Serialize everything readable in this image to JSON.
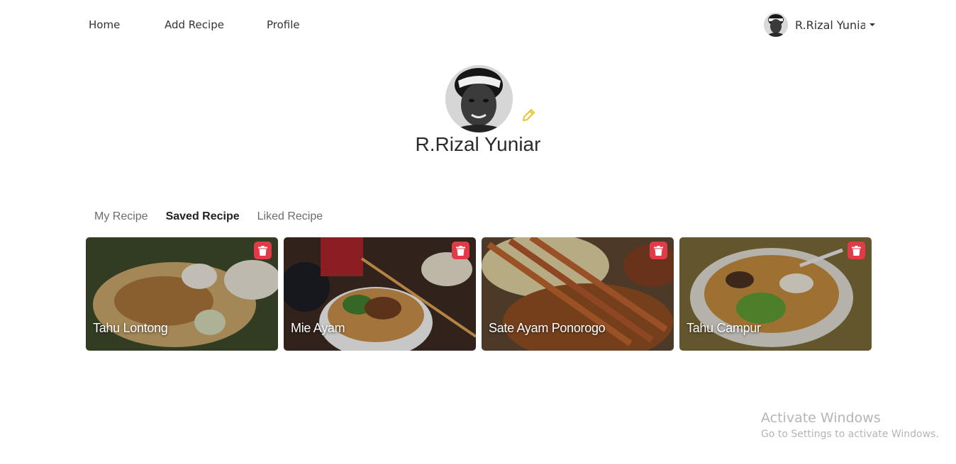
{
  "nav": {
    "links": [
      "Home",
      "Add Recipe",
      "Profile"
    ],
    "user_name": "R.Rizal Yuniar"
  },
  "profile": {
    "name": "R.Rizal Yuniar",
    "edit_icon": "pencil-icon",
    "accent": "#e6c62e"
  },
  "tabs": [
    {
      "label": "My Recipe",
      "active": false
    },
    {
      "label": "Saved Recipe",
      "active": true
    },
    {
      "label": "Liked Recipe",
      "active": false
    }
  ],
  "recipes": [
    {
      "title": "Tahu Lontong"
    },
    {
      "title": "Mie Ayam"
    },
    {
      "title": "Sate Ayam Ponorogo"
    },
    {
      "title": "Tahu Campur"
    }
  ],
  "delete_color": "#e03b47",
  "watermark": {
    "title": "Activate Windows",
    "subtitle": "Go to Settings to activate Windows."
  }
}
